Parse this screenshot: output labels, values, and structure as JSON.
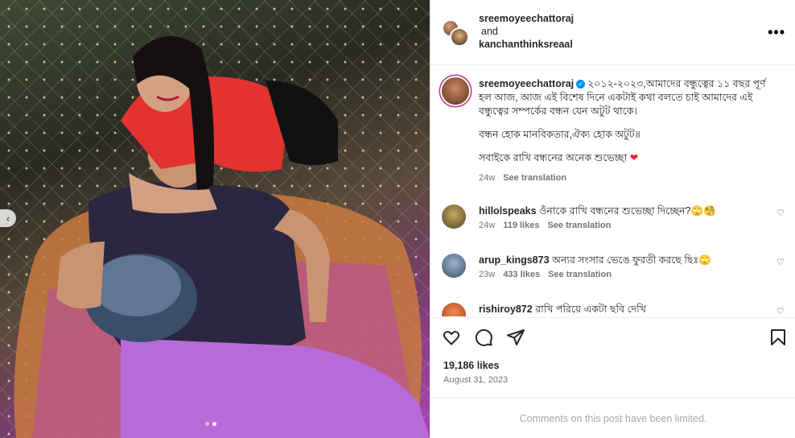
{
  "header": {
    "user1": "sreemoyeechattoraj",
    "conjunction": "and",
    "user2": "kanchanthinksreaal",
    "more_icon": "more-horizontal-icon"
  },
  "caption": {
    "user": "sreemoyeechattoraj",
    "line1": "২০১২-২০২৩,আমাদের বন্ধুত্বের ১১ বছর পূর্ণ হল আজ, আজ এই বিশেষ দিনে একটাই কথা বলতে চাই আমাদের এই বন্ধুত্বের সম্পর্কের বন্ধন যেন অটুট থাকে।",
    "line2": "বন্ধন হোক মানবিকতার,ঐক্য হোক অটুট॥",
    "line3": "সবাইকে রাখি বন্ধনের অনেক শুভেচ্ছা",
    "heart_emoji": "❤",
    "time": "24w",
    "translate": "See translation"
  },
  "comments": [
    {
      "user": "hillolspeaks",
      "text": "ওঁনাকে রাখি বন্ধনের শুভেচ্ছা দিচ্ছেন?🙄🧐",
      "time": "24w",
      "likes": "119 likes",
      "translate": "See translation",
      "avatar_color": "#7a6a3a"
    },
    {
      "user": "arup_kings873",
      "text": "অন্যর সংসার ভেঙে ফুরতী করছে ছিঃ🙄",
      "time": "23w",
      "likes": "433 likes",
      "translate": "See translation",
      "avatar_color": "#4a6b8a"
    },
    {
      "user": "rishiroy872",
      "text": "রাখি পরিয়ে একটা ছবি দেখি",
      "time": "",
      "likes": "",
      "translate": "",
      "avatar_color": "#d05a30"
    }
  ],
  "actions": {
    "icons": [
      "heart-icon",
      "comment-icon",
      "share-icon",
      "bookmark-icon"
    ],
    "likes": "19,186 likes",
    "date": "August 31, 2023"
  },
  "footer": {
    "limited": "Comments on this post have been limited."
  },
  "carousel": {
    "prev_icon": "chevron-left-icon",
    "slide_count": 2,
    "active_slide": 2
  }
}
